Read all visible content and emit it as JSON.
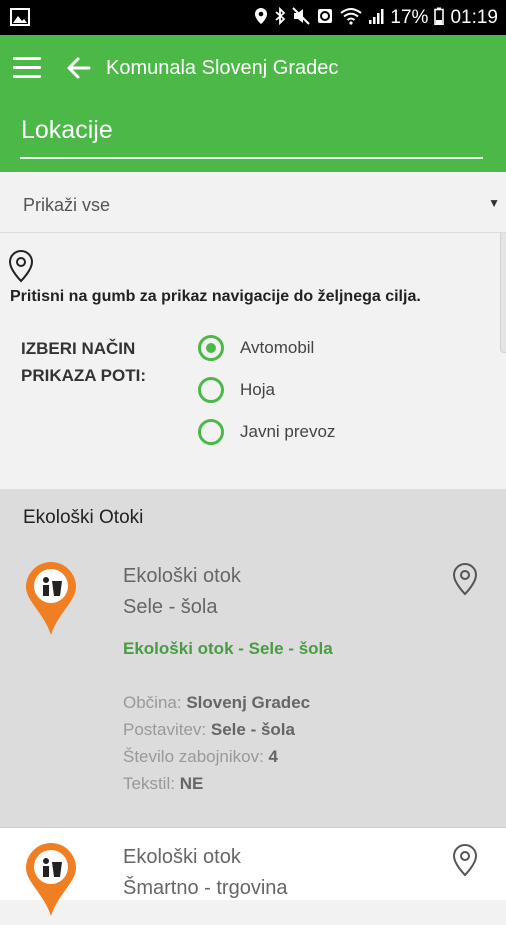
{
  "status_bar": {
    "battery": "17%",
    "time": "01:19"
  },
  "app_bar": {
    "title": "Komunala Slovenj Gradec"
  },
  "section": {
    "title": "Lokacije"
  },
  "filter": {
    "selected": "Prikaži vse"
  },
  "navigation": {
    "hint": "Pritisni na gumb za prikaz navigacije do željnega cilja.",
    "route_label": "IZBERI NAČIN PRIKAZA POTI:",
    "options": [
      {
        "label": "Avtomobil",
        "checked": true
      },
      {
        "label": "Hoja",
        "checked": false
      },
      {
        "label": "Javni prevoz",
        "checked": false
      }
    ]
  },
  "list": {
    "category": "Ekološki Otoki",
    "items": [
      {
        "title_line1": "Ekološki otok",
        "title_line2": "Sele - šola",
        "link": "Ekološki otok - Sele - šola",
        "obcina_label": "Občina:",
        "obcina": "Slovenj Gradec",
        "postavitev_label": "Postavitev:",
        "postavitev": "Sele - šola",
        "stevilo_label": "Število zabojnikov:",
        "stevilo": "4",
        "tekstil_label": "Tekstil:",
        "tekstil": "NE"
      },
      {
        "title_line1": "Ekološki otok",
        "title_line2": "Šmartno - trgovina"
      }
    ]
  },
  "colors": {
    "primary": "#4cb848",
    "marker": "#f07e22",
    "link": "#4a9b45"
  }
}
